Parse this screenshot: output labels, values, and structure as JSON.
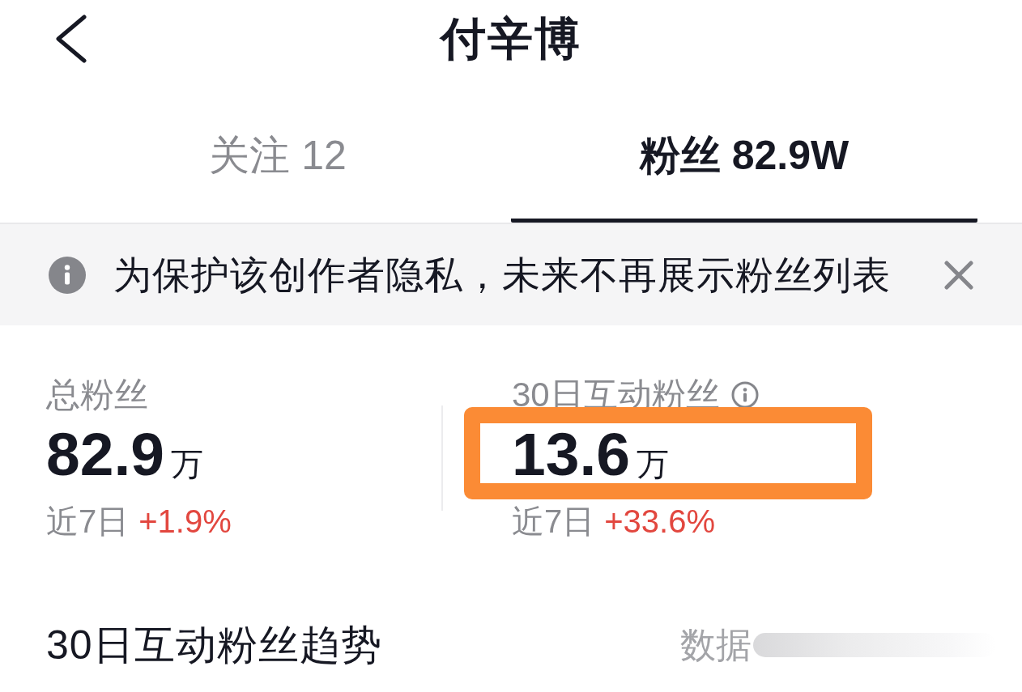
{
  "header": {
    "title": "付辛博"
  },
  "tabs": [
    {
      "label": "关注 12",
      "selected": false
    },
    {
      "label": "粉丝 82.9W",
      "selected": true
    }
  ],
  "notice": {
    "text": "为保护该创作者隐私，未来不再展示粉丝列表"
  },
  "stats": [
    {
      "label": "总粉丝",
      "info": false,
      "value": "82.9",
      "unit": "万",
      "period": "近7日",
      "change": "+1.9%",
      "highlighted": false
    },
    {
      "label": "30日互动粉丝",
      "info": true,
      "value": "13.6",
      "unit": "万",
      "period": "近7日",
      "change": "+33.6%",
      "highlighted": true
    }
  ],
  "trend": {
    "title": "30日互动粉丝趋势",
    "note": "数据"
  }
}
